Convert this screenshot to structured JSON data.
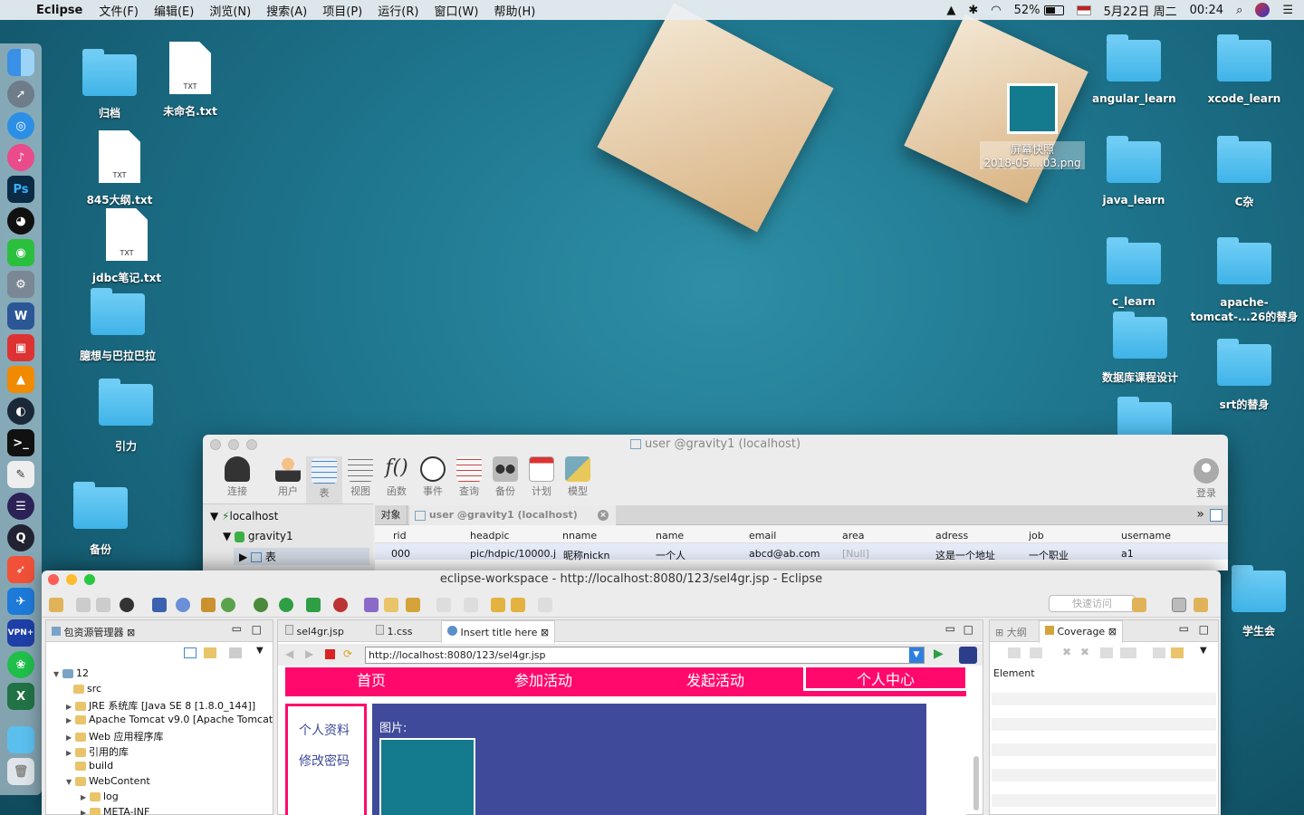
{
  "menubar": {
    "app": "Eclipse",
    "items": [
      "文件(F)",
      "编辑(E)",
      "浏览(N)",
      "搜索(A)",
      "项目(P)",
      "运行(R)",
      "窗口(W)",
      "帮助(H)"
    ],
    "battery": "52%",
    "date": "5月22日 周二",
    "time": "00:24"
  },
  "dock": [
    "Finder",
    "Launchpad",
    "Safari",
    "iTunes",
    "Ps",
    "QQ",
    "WeChat",
    "System Preferences",
    "W",
    "Remote",
    "VLC",
    "Steam",
    "Terminal",
    "TextEdit",
    "Eclipse",
    "QuickTime",
    "Swift",
    "Xcode",
    "VPN+",
    "Vine",
    "X",
    "Folder",
    "Trash"
  ],
  "desktop": {
    "left": [
      {
        "label": "归档",
        "kind": "folder"
      },
      {
        "label": "未命名.txt",
        "kind": "txt"
      },
      {
        "label": "845大纲.txt",
        "kind": "txt"
      },
      {
        "label": "jdbc笔记.txt",
        "kind": "txt"
      },
      {
        "label": "臆想与巴拉巴拉",
        "kind": "folder"
      },
      {
        "label": "引力",
        "kind": "folder"
      },
      {
        "label": "备份",
        "kind": "folder"
      }
    ],
    "right": [
      {
        "label": "angular_learn"
      },
      {
        "label": "xcode_learn"
      },
      {
        "label": "java_learn"
      },
      {
        "label": "C杂"
      },
      {
        "label": "c_learn"
      },
      {
        "label": "apache-tomcat-...26的替身"
      },
      {
        "label": "数据库课程设计"
      },
      {
        "label": "srt的替身"
      },
      {
        "label": "学生会"
      }
    ],
    "screenshot": {
      "line1": "屏幕快照",
      "line2": "2018-05....03.png"
    },
    "txt_badge": "TXT"
  },
  "navicat": {
    "title": "user @gravity1 (localhost)",
    "tools": [
      "连接",
      "用户",
      "表",
      "视图",
      "函数",
      "事件",
      "查询",
      "备份",
      "计划",
      "模型"
    ],
    "login": "登录",
    "tree": {
      "server": "localhost",
      "db": "gravity1",
      "node": "表"
    },
    "tabs": {
      "objects": "对象",
      "table_tab": "user @gravity1 (localhost)"
    },
    "columns": [
      "rid",
      "headpic",
      "nname",
      "name",
      "email",
      "area",
      "adress",
      "job",
      "username"
    ],
    "row": [
      "000",
      "pic/hdpic/10000.j",
      "昵称nickn",
      "一个人",
      "abcd@ab.com",
      "[Null]",
      "这是一个地址",
      "一个职业",
      "a1"
    ]
  },
  "eclipse": {
    "title": "eclipse-workspace - http://localhost:8080/123/sel4gr.jsp - Eclipse",
    "quick_access": "快速访问",
    "explorer": {
      "title": "包资源管理器",
      "items": [
        "12",
        "src",
        "JRE 系统库 [Java SE 8 [1.8.0_144]]",
        "Apache Tomcat v9.0 [Apache Tomcat",
        "Web 应用程序库",
        "引用的库",
        "build",
        "WebContent",
        "log",
        "META-INF"
      ]
    },
    "editor_tabs": [
      "sel4gr.jsp",
      "1.css",
      "Insert title here"
    ],
    "url": "http://localhost:8080/123/sel4gr.jsp",
    "page": {
      "nav": [
        "首页",
        "参加活动",
        "发起活动",
        "个人中心"
      ],
      "side": [
        "个人资料",
        "修改密码"
      ],
      "pic_label": "图片:"
    },
    "outline_tabs": [
      "大纲",
      "Coverage"
    ],
    "coverage_header": "Element"
  },
  "colors": {
    "accent": "#ff0a6c",
    "panel": "#3f4a9a",
    "teal": "#147a8d"
  }
}
